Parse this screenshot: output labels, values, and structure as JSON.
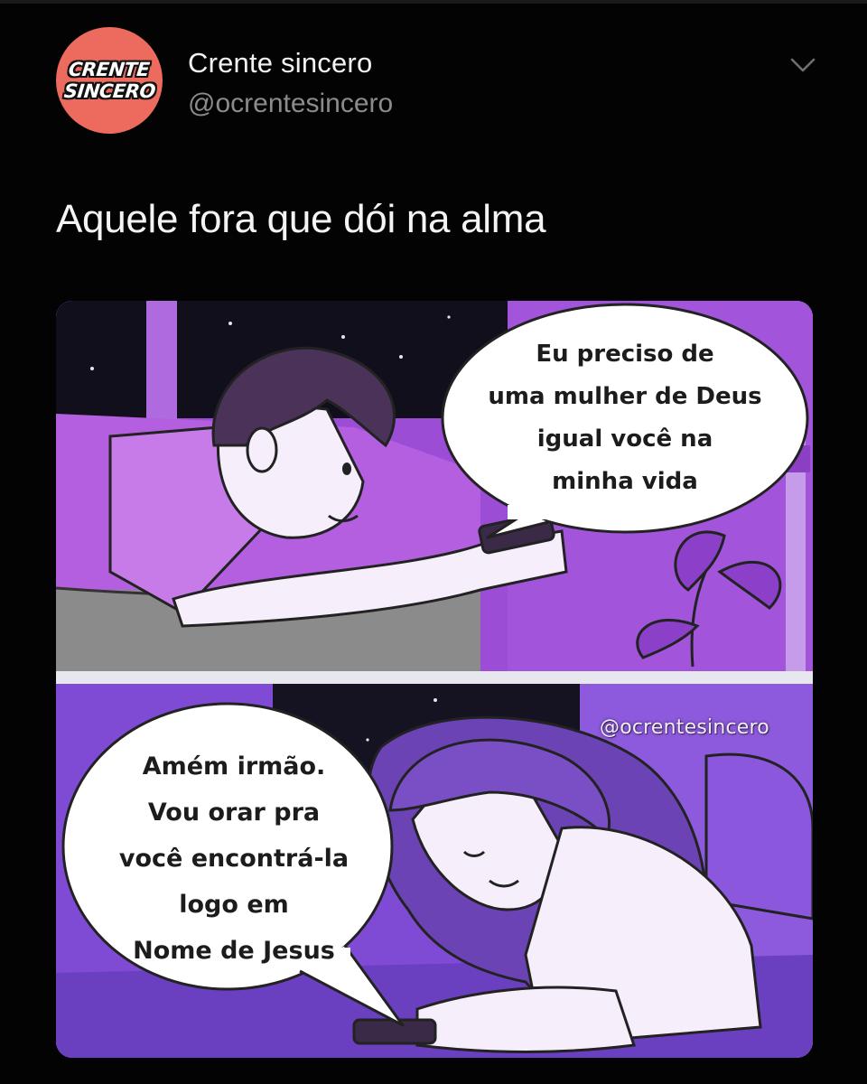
{
  "header": {
    "avatar_line1": "CRENTE",
    "avatar_line2": "SINCERO",
    "display_name": "Crente sincero",
    "handle": "@ocrentesincero",
    "menu_icon": "chevron-down-icon"
  },
  "tweet": {
    "text": "Aquele fora que dói na alma"
  },
  "media": {
    "panel_top_bubble": [
      "Eu preciso de",
      "uma mulher de Deus",
      "igual você na",
      "minha vida"
    ],
    "panel_bottom_bubble": [
      "Amém irmão.",
      "Vou orar pra",
      "você encontrá-la",
      "logo em",
      "Nome de Jesus"
    ],
    "watermark": "@ocrentesincero"
  },
  "colors": {
    "background": "#030303",
    "avatar": "#ec6a5e",
    "name": "#f2f2f2",
    "handle": "#8b8b8b",
    "panel_purple": "#9a4ad3",
    "panel_violet": "#7a45cf"
  }
}
